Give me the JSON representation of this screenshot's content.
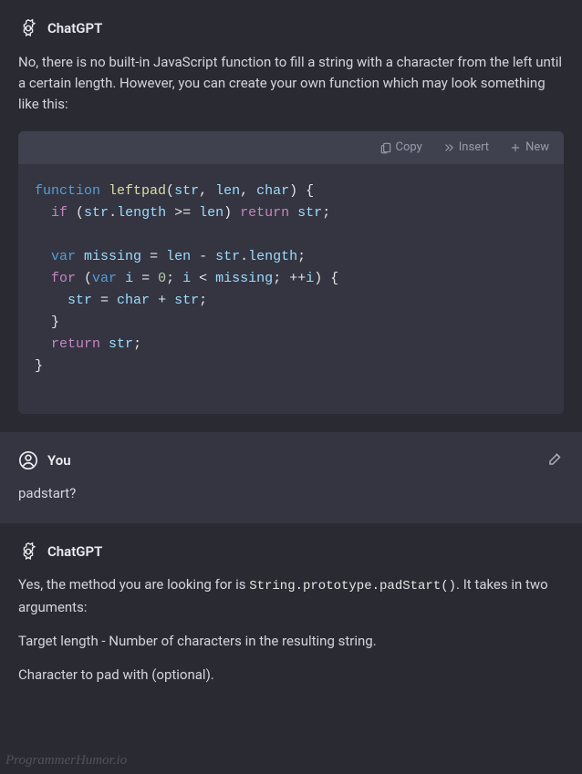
{
  "messages": {
    "gpt1": {
      "sender": "ChatGPT",
      "paragraph": "No, there is no built-in JavaScript function to fill a string with a character from the left until a certain length. However, you can create your own function which may look something like this:"
    },
    "user1": {
      "sender": "You",
      "text": "padstart?"
    },
    "gpt2": {
      "sender": "ChatGPT",
      "para1_pre": "Yes, the method you are looking for is ",
      "para1_code": "String.prototype.padStart()",
      "para1_post": ". It takes in two arguments:",
      "para2": "Target length - Number of characters in the resulting string.",
      "para3": "Character to pad with (optional)."
    }
  },
  "toolbar": {
    "copy": "Copy",
    "insert": "Insert",
    "new": "New"
  },
  "code": {
    "l1_kw": "function",
    "l1_name": "leftpad",
    "l1_p1": "str",
    "l1_p2": "len",
    "l1_p3": "char",
    "l2_if": "if",
    "l2_str": "str",
    "l2_len_prop": "length",
    "l2_len": "len",
    "l2_return": "return",
    "l2_str2": "str",
    "l4_var": "var",
    "l4_missing": "missing",
    "l4_len": "len",
    "l4_str": "str",
    "l4_len_prop": "length",
    "l5_for": "for",
    "l5_var": "var",
    "l5_i1": "i",
    "l5_zero": "0",
    "l5_i2": "i",
    "l5_missing": "missing",
    "l5_i3": "i",
    "l6_str1": "str",
    "l6_char": "char",
    "l6_str2": "str",
    "l8_return": "return",
    "l8_str": "str"
  },
  "watermark": "ProgrammerHumor.io",
  "chart_data": null
}
